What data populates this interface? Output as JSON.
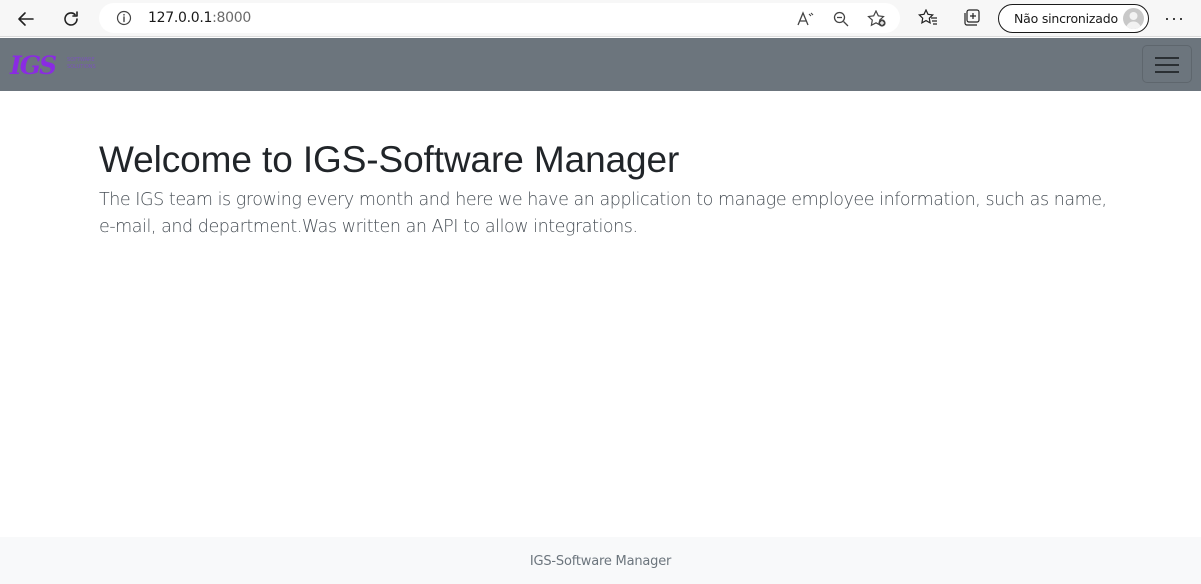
{
  "browser": {
    "url_host": "127.0.0.1",
    "url_port": ":8000",
    "profile_label": "Não sincronizado",
    "more_label": "···"
  },
  "navbar": {
    "logo_text": "IGS",
    "logo_sub_line1": "SOFTWARE",
    "logo_sub_line2": "SOLUTIONS"
  },
  "main": {
    "title": "Welcome to IGS-Software Manager",
    "description": "The IGS team is growing every month and here we have an application to manage employee information, such as name, e-mail, and department.Was written an API to allow integrations."
  },
  "footer": {
    "text": "IGS-Software Manager"
  },
  "colors": {
    "navbar_bg": "#6c757d",
    "footer_bg": "#f8f9fa",
    "logo_accent": "#8a2be2"
  }
}
